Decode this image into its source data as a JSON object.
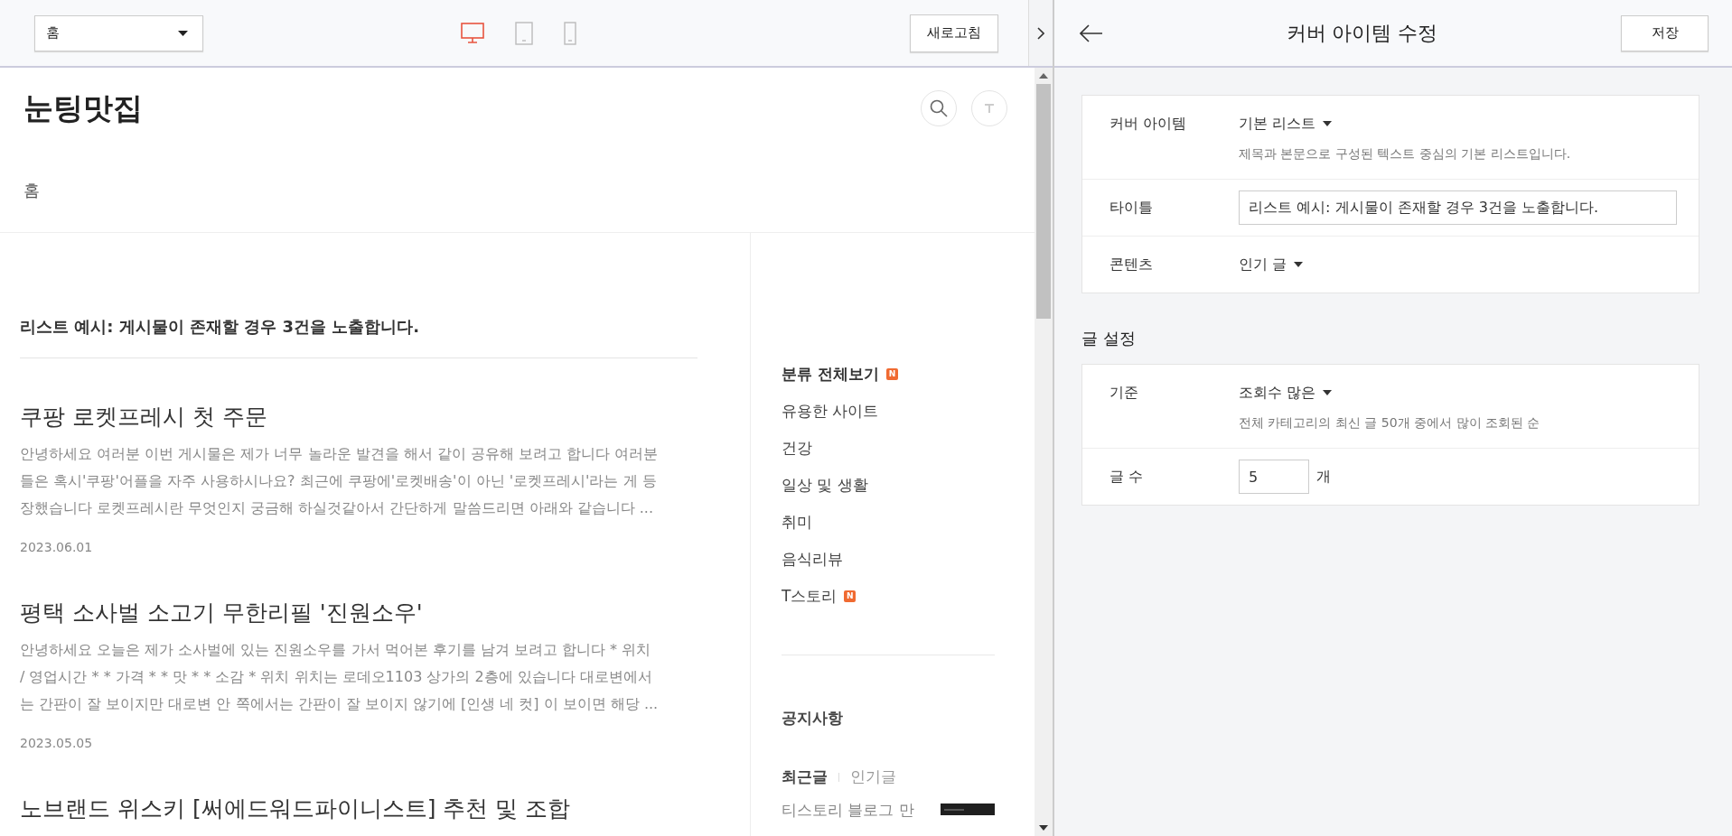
{
  "preview_toolbar": {
    "page_select": "홈",
    "devices": [
      {
        "kind": "desktop",
        "selected": true
      },
      {
        "kind": "tablet",
        "selected": false
      },
      {
        "kind": "mobile",
        "selected": false
      }
    ],
    "refresh_button": "새로고침"
  },
  "blog": {
    "title": "눈팅맛집",
    "nav": [
      "홈"
    ],
    "list_heading": "리스트 예시: 게시물이 존재할 경우 3건을 노출합니다.",
    "posts": [
      {
        "title": "쿠팡 로켓프레시 첫 주문",
        "excerpt": [
          "안녕하세요 여러분 이번 게시물은 제가 너무 놀라운 발견을 해서 같이 공유해 보려고 합니다 여러분",
          "들은 혹시'쿠팡'어플을 자주 사용하시나요? 최근에 쿠팡에'로켓배송'이 아닌 '로켓프레시'라는 게 등",
          "장했습니다 로켓프레시란 무엇인지 궁금해 하실것같아서 간단하게 말씀드리면 아래와 같습니다 ..."
        ],
        "date": "2023.06.01"
      },
      {
        "title": "평택 소사벌 소고기 무한리필 '진원소우'",
        "excerpt": [
          "안녕하세요 오늘은 제가 소사벌에 있는 진원소우를 가서 먹어본 후기를 남겨 보려고 합니다 * 위치",
          "/ 영업시간 * * 가격 * * 맛 * * 소감 * 위치 위치는 로데오1103 상가의 2층에 있습니다 대로변에서",
          "는 간판이 잘 보이지만 대로변 안 쪽에서는 간판이 잘 보이지 않기에 [인생 네 컷] 이 보이면 해당 ..."
        ],
        "date": "2023.05.05"
      },
      {
        "title": "노브랜드 위스키 [써에드워드파이니스트] 추천 및 조합"
      }
    ],
    "categories": [
      {
        "label": "분류 전체보기",
        "badge": "N",
        "kind": "all"
      },
      {
        "label": "유용한 사이트",
        "kind": "item"
      },
      {
        "label": "건강",
        "kind": "item"
      },
      {
        "label": "일상 및 생활",
        "kind": "item"
      },
      {
        "label": "취미",
        "kind": "item"
      },
      {
        "label": "음식리뷰",
        "kind": "item"
      },
      {
        "label": "T스토리",
        "badge": "N",
        "kind": "item"
      }
    ],
    "notice_heading": "공지사항",
    "post_tabs": [
      {
        "label": "최근글",
        "selected": true
      },
      {
        "label": "인기글",
        "selected": false
      }
    ],
    "recent_post": "티스토리 블로그 만"
  },
  "editor": {
    "title": "커버 아이템 수정",
    "save_button": "저장",
    "cover_rows": [
      {
        "label": "커버 아이템",
        "kind": "dropdown",
        "value": "기본 리스트",
        "description": "제목과 본문으로 구성된 텍스트 중심의 기본 리스트입니다."
      },
      {
        "label": "타이틀",
        "kind": "text",
        "value": "리스트 예시: 게시물이 존재할 경우 3건을 노출합니다."
      },
      {
        "label": "콘텐츠",
        "kind": "dropdown",
        "value": "인기 글"
      }
    ],
    "post_settings_heading": "글 설정",
    "post_rows": [
      {
        "label": "기준",
        "kind": "dropdown",
        "value": "조회수 많은",
        "description": "전체 카테고리의 최신 글 50개 중에서 많이 조회된 순"
      },
      {
        "label": "글 수",
        "kind": "number",
        "value": "5",
        "unit": "개"
      }
    ]
  }
}
